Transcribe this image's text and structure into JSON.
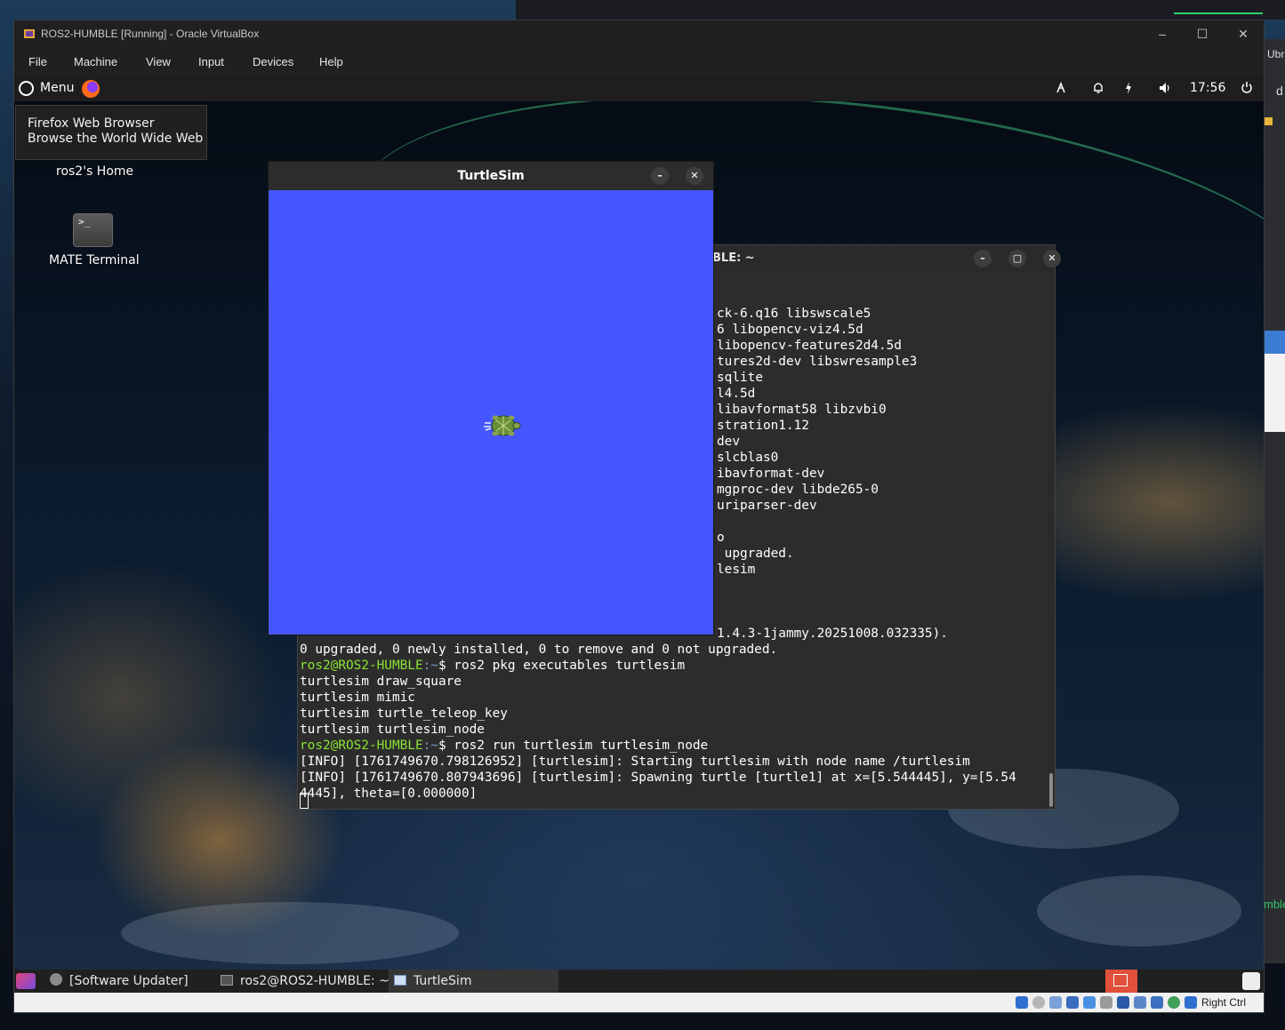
{
  "host": {
    "right_strip": {
      "top_text": "Ubr",
      "mid_text": "d",
      "bottom_text": "mble"
    }
  },
  "vbox": {
    "title": "ROS2-HUMBLE [Running] - Oracle VirtualBox",
    "controls": {
      "minimize": "–",
      "maximize": "☐",
      "close": "✕"
    },
    "menu": [
      "File",
      "Machine",
      "View",
      "Input",
      "Devices",
      "Help"
    ],
    "status": {
      "host_key": "Right Ctrl"
    }
  },
  "guest_panel": {
    "menu_label": "Menu",
    "icons": [
      "network-icon",
      "notification-bell-icon",
      "power-status-icon",
      "volume-icon",
      "power-icon"
    ],
    "clock": "17:56"
  },
  "tooltip": {
    "line1": "Firefox Web Browser",
    "line2": "Browse the World Wide Web"
  },
  "desktop_icons": [
    {
      "label": "ros2's Home",
      "icon": "home-folder-icon"
    },
    {
      "label": "MATE Terminal",
      "icon": "terminal-icon",
      "glyph": ">_"
    }
  ],
  "terminal": {
    "title_partial": "BLE: ~",
    "upper_lines": [
      "ck-6.q16 libswscale5",
      "6 libopencv-viz4.5d",
      "libopencv-features2d4.5d",
      "tures2d-dev libswresample3",
      "sqlite",
      "l4.5d",
      "libavformat58 libzvbi0",
      "stration1.12",
      "dev",
      "slcblas0",
      "ibavformat-dev",
      "mgproc-dev libde265-0",
      "uriparser-dev",
      "",
      "o",
      " upgraded.",
      "lesim",
      "",
      "",
      "",
      "1.4.3-1jammy.20251008.032335)."
    ],
    "lines": [
      {
        "text": "0 upgraded, 0 newly installed, 0 to remove and 0 not upgraded."
      },
      {
        "user": "ros2@ROS2-HUMBLE",
        "path": ":~",
        "cmd": "$ ros2 pkg executables turtlesim"
      },
      {
        "text": "turtlesim draw_square"
      },
      {
        "text": "turtlesim mimic"
      },
      {
        "text": "turtlesim turtle_teleop_key"
      },
      {
        "text": "turtlesim turtlesim_node"
      },
      {
        "user": "ros2@ROS2-HUMBLE",
        "path": ":~",
        "cmd": "$ ros2 run turtlesim turtlesim_node"
      },
      {
        "text": "[INFO] [1761749670.798126952] [turtlesim]: Starting turtlesim with node name /turtlesim"
      },
      {
        "text": "[INFO] [1761749670.807943696] [turtlesim]: Spawning turtle [turtle1] at x=[5.544445], y=[5.54"
      },
      {
        "text": "4445], theta=[0.000000]"
      }
    ]
  },
  "turtlesim": {
    "title": "TurtleSim",
    "background_color": "#4556ff"
  },
  "taskbar": {
    "items": [
      {
        "label": "[Software Updater]",
        "icon": "software-updater-icon"
      },
      {
        "label": "ros2@ROS2-HUMBLE: ~",
        "icon": "terminal-icon"
      },
      {
        "label": "TurtleSim",
        "icon": "window-icon",
        "active": true
      }
    ]
  }
}
